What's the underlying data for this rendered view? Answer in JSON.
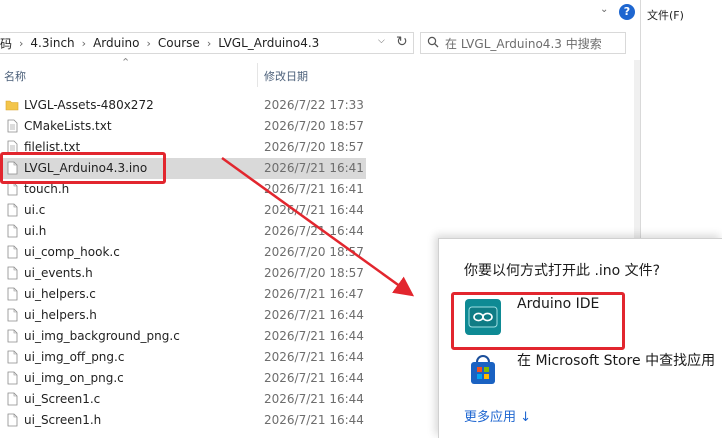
{
  "header": {
    "file_menu": "文件(F)",
    "help_icon": "?"
  },
  "address": {
    "crumbs": [
      "码",
      "4.3inch",
      "Arduino",
      "Course",
      "LVGL_Arduino4.3"
    ],
    "search_placeholder": "在 LVGL_Arduino4.3 中搜索"
  },
  "columns": {
    "name": "名称",
    "date": "修改日期"
  },
  "files": [
    {
      "name": "LVGL-Assets-480x272",
      "date": "2026/7/22 17:33",
      "type": "folder"
    },
    {
      "name": "CMakeLists.txt",
      "date": "2026/7/20 18:57",
      "type": "text"
    },
    {
      "name": "filelist.txt",
      "date": "2026/7/20 18:57",
      "type": "text"
    },
    {
      "name": "LVGL_Arduino4.3.ino",
      "date": "2026/7/21 16:41",
      "type": "file",
      "selected": true
    },
    {
      "name": "touch.h",
      "date": "2026/7/21 16:41",
      "type": "code"
    },
    {
      "name": "ui.c",
      "date": "2026/7/21 16:44",
      "type": "code"
    },
    {
      "name": "ui.h",
      "date": "2026/7/21 16:44",
      "type": "code"
    },
    {
      "name": "ui_comp_hook.c",
      "date": "2026/7/20 18:57",
      "type": "code"
    },
    {
      "name": "ui_events.h",
      "date": "2026/7/20 18:57",
      "type": "code"
    },
    {
      "name": "ui_helpers.c",
      "date": "2026/7/21 16:47",
      "type": "code"
    },
    {
      "name": "ui_helpers.h",
      "date": "2026/7/21 16:44",
      "type": "code"
    },
    {
      "name": "ui_img_background_png.c",
      "date": "2026/7/21 16:44",
      "type": "code"
    },
    {
      "name": "ui_img_off_png.c",
      "date": "2026/7/21 16:44",
      "type": "code"
    },
    {
      "name": "ui_img_on_png.c",
      "date": "2026/7/21 16:44",
      "type": "code"
    },
    {
      "name": "ui_Screen1.c",
      "date": "2026/7/21 16:44",
      "type": "code"
    },
    {
      "name": "ui_Screen1.h",
      "date": "2026/7/21 16:44",
      "type": "code"
    }
  ],
  "open_with": {
    "title": "你要以何方式打开此 .ino 文件?",
    "apps": [
      {
        "label": "Arduino IDE",
        "icon": "arduino-icon"
      },
      {
        "label": "在 Microsoft Store 中查找应用",
        "icon": "microsoft-store-icon"
      }
    ],
    "more_apps": "更多应用 ↓"
  },
  "colors": {
    "highlight": "#e2262e",
    "link": "#1e66d0",
    "selection": "#d9d9d9"
  }
}
